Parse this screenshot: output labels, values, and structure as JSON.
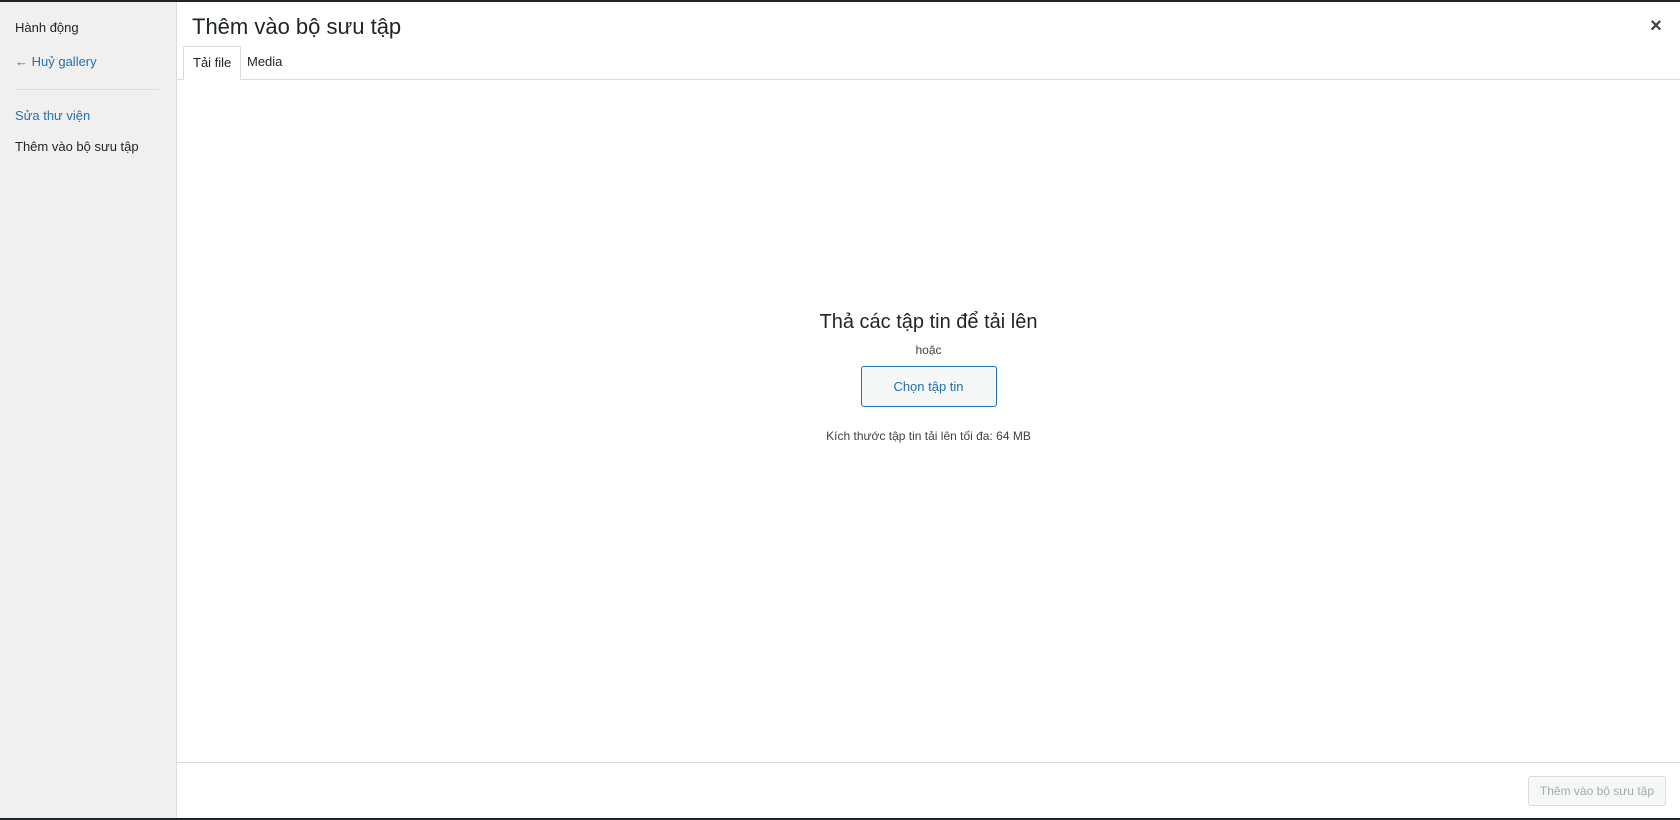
{
  "sidebar": {
    "heading": "Hành động",
    "cancel_link": "← Huỷ gallery",
    "edit_link": "Sửa thư viện",
    "active_item": "Thêm vào bộ sưu tập"
  },
  "frame": {
    "title": "Thêm vào bộ sưu tập",
    "close_icon": "×"
  },
  "tabs": [
    {
      "label": "Tải file",
      "active": true
    },
    {
      "label": "Media",
      "active": false
    }
  ],
  "uploader": {
    "drop_title": "Thả các tập tin để tải lên",
    "or_text": "hoặc",
    "select_button": "Chọn tập tin",
    "max_size": "Kích thước tập tin tải lên tối đa: 64 MB"
  },
  "toolbar": {
    "insert_button": "Thêm vào bộ sưu tập"
  },
  "colors": {
    "accent": "#2271b1",
    "sidebar_bg": "#f0f0f1",
    "border": "#dcdcde",
    "disabled_text": "#a7aaad"
  }
}
